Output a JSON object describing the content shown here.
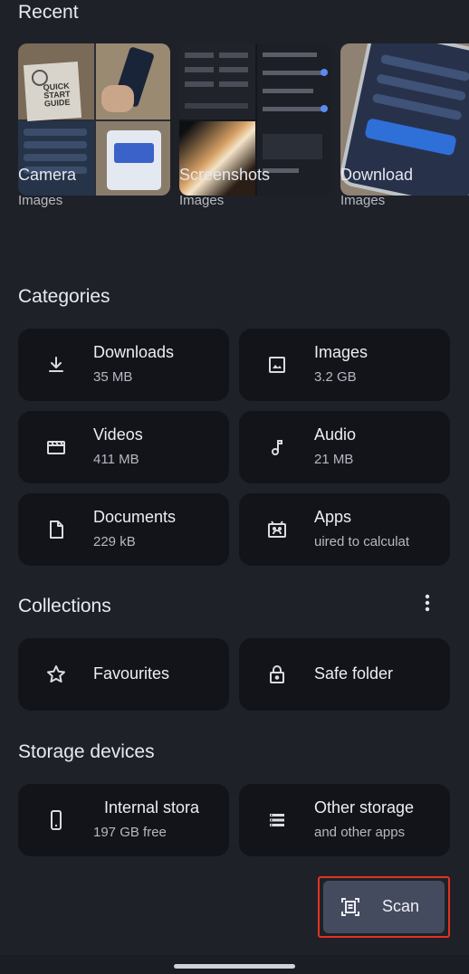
{
  "recent": {
    "title": "Recent",
    "items": [
      {
        "name": "Camera",
        "sub": "Images"
      },
      {
        "name": "Screenshots",
        "sub": "Images"
      },
      {
        "name": "Download",
        "sub": "Images"
      }
    ],
    "camera_thumb_text": "QUICK START GUIDE"
  },
  "categories": {
    "title": "Categories",
    "items": [
      {
        "label": "Downloads",
        "sub": "35 MB",
        "icon": "download-icon"
      },
      {
        "label": "Images",
        "sub": "3.2 GB",
        "icon": "image-icon"
      },
      {
        "label": "Videos",
        "sub": "411 MB",
        "icon": "video-icon"
      },
      {
        "label": "Audio",
        "sub": "21 MB",
        "icon": "music-note-icon"
      },
      {
        "label": "Documents",
        "sub": "229 kB",
        "icon": "document-icon"
      },
      {
        "label": "Apps",
        "sub": "uired to calculat",
        "icon": "android-app-icon"
      }
    ]
  },
  "collections": {
    "title": "Collections",
    "items": [
      {
        "label": "Favourites",
        "icon": "star-icon"
      },
      {
        "label": "Safe folder",
        "icon": "lock-icon"
      }
    ]
  },
  "storage": {
    "title": "Storage devices",
    "items": [
      {
        "label": "Internal stora",
        "sub": "197 GB free",
        "icon": "phone-icon"
      },
      {
        "label": "Other storage",
        "sub": "and other apps",
        "icon": "storage-list-icon"
      }
    ]
  },
  "scan": {
    "label": "Scan",
    "icon": "document-scanner-icon"
  },
  "colors": {
    "background": "#1f2129",
    "tile": "#12141a",
    "scan_button": "#454b5f",
    "highlight": "#e0321f"
  }
}
